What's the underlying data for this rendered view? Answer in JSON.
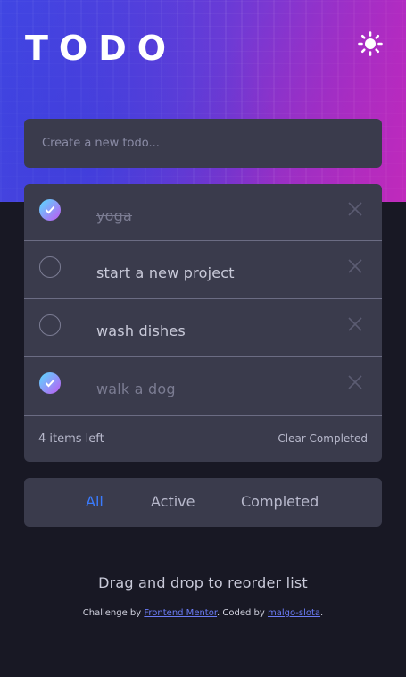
{
  "app": {
    "title": "TODO",
    "theme_toggle_icon": "sun-icon"
  },
  "new_todo": {
    "placeholder": "Create a new todo..."
  },
  "todos": [
    {
      "text": "yoga",
      "completed": true
    },
    {
      "text": "start a new project",
      "completed": false
    },
    {
      "text": "wash dishes",
      "completed": false
    },
    {
      "text": "walk a dog",
      "completed": true
    }
  ],
  "footer": {
    "items_left": "4 items left",
    "clear_completed": "Clear Completed"
  },
  "filters": {
    "all": "All",
    "active": "Active",
    "completed": "Completed",
    "selected": "All"
  },
  "hint": "Drag and drop to reorder list",
  "attribution": {
    "prefix": "Challenge by ",
    "link1": "Frontend Mentor",
    "middle": ". Coded by ",
    "link2": "malgo-slota",
    "suffix": "."
  },
  "colors": {
    "background": "#181824",
    "card": "#3a3b4c",
    "accent": "#3a7bfd",
    "check_gradient_start": "#57ddff",
    "check_gradient_end": "#c058f3"
  }
}
